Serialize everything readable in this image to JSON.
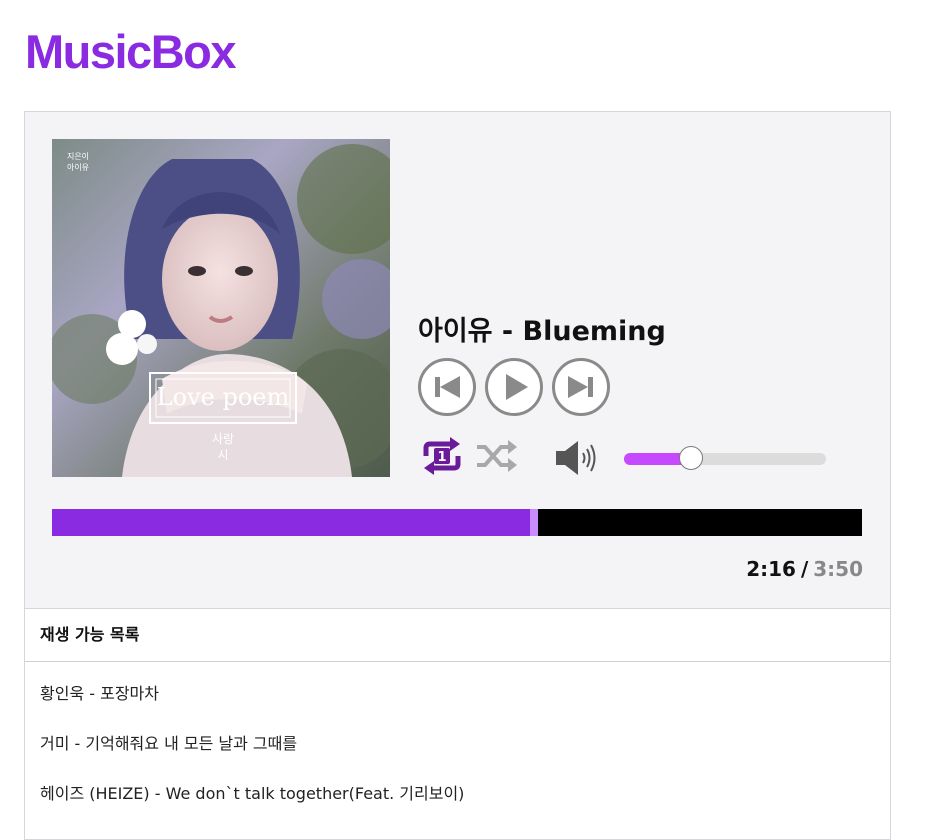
{
  "app": {
    "brand": "MusicBox"
  },
  "player": {
    "now_playing": "아이유 - Blueming",
    "album_art": {
      "artist_small": "지은이",
      "artist_small2": "아이유",
      "logo_text": "Love poem",
      "korean_title_1": "사랑",
      "korean_title_2": "시"
    },
    "controls": {
      "prev_icon": "skip-previous-icon",
      "play_icon": "play-icon",
      "next_icon": "skip-next-icon",
      "repeat_icon": "repeat-one-icon",
      "shuffle_icon": "shuffle-icon",
      "volume_icon": "volume-icon"
    },
    "volume_fraction": 0.33,
    "progress_fraction": 0.59,
    "current_time": "2:16",
    "time_separator": "/",
    "duration": "3:50",
    "colors": {
      "accent": "#8a2be2",
      "volume": "#c649ff",
      "repeat": "#6a1b9a",
      "inactive": "#9e9e9e"
    }
  },
  "playlist": {
    "title": "재생 가능 목록",
    "items": [
      "황인욱 - 포장마차",
      "거미 - 기억해줘요 내 모든 날과 그때를",
      "헤이즈 (HEIZE) - We don`t talk together(Feat. 기리보이)"
    ]
  }
}
